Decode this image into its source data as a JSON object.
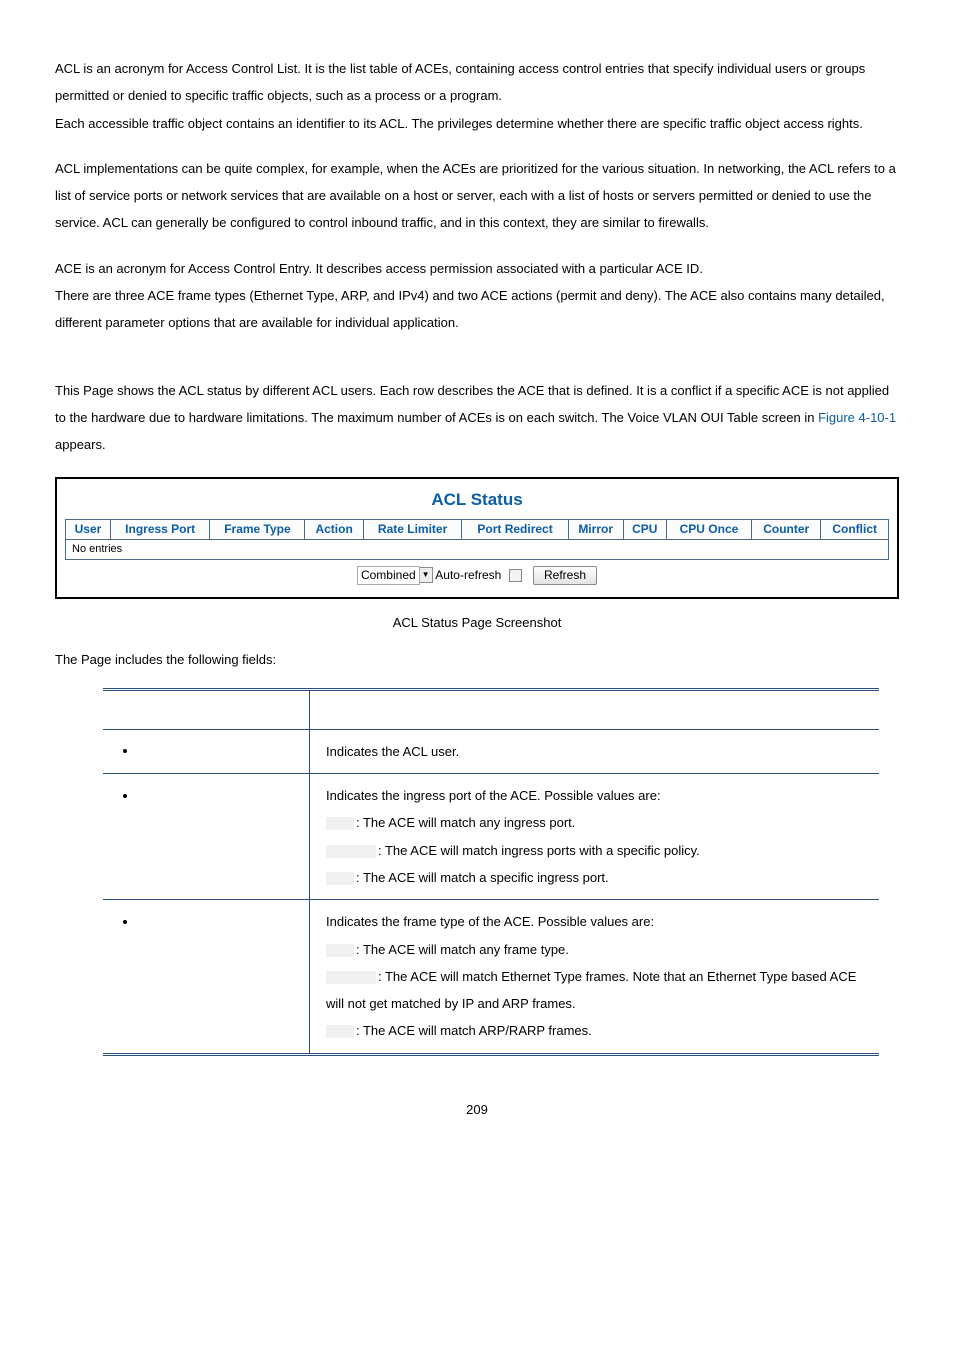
{
  "para1": "ACL is an acronym for Access Control List. It is the list table of ACEs, containing access control entries that specify individual users or groups permitted or denied to specific traffic objects, such as a process or a program.",
  "para1b": "Each accessible traffic object contains an identifier to its ACL. The privileges determine whether there are specific traffic object access rights.",
  "para2": "ACL implementations can be quite complex, for example, when the ACEs are prioritized for the various situation. In networking, the ACL refers to a list of service ports or network services that are available on a host or server, each with a list of hosts or servers permitted or denied to use the service. ACL can generally be configured to control inbound traffic, and in this context, they are similar to firewalls.",
  "para3a": "ACE is an acronym for Access Control Entry. It describes access permission associated with a particular ACE ID.",
  "para3b": "There are three ACE frame types (Ethernet Type, ARP, and IPv4) and two ACE actions (permit and deny). The ACE also contains many detailed, different parameter options that are available for individual application.",
  "para4_pre": "This Page shows the ACL status by different ACL users. Each row describes the ACE that is defined. It is a conflict if a specific ACE is not applied to the hardware due to hardware limitations. The maximum number of ACEs is ",
  "para4_post": " on each switch. The Voice VLAN OUI Table screen in ",
  "figref": "Figure 4-10-1",
  "para4_end": " appears.",
  "ss": {
    "title": "ACL Status",
    "cols": [
      "User",
      "Ingress Port",
      "Frame Type",
      "Action",
      "Rate Limiter",
      "Port Redirect",
      "Mirror",
      "CPU",
      "CPU Once",
      "Counter",
      "Conflict"
    ],
    "row": "No entries",
    "select_value": "Combined",
    "auto_label": "Auto-refresh",
    "refresh": "Refresh"
  },
  "figcap": "ACL Status Page Screenshot",
  "fields_lead": "The Page includes the following fields:",
  "fields": {
    "user": {
      "desc": "Indicates the ACL user."
    },
    "ingress": {
      "desc": "Indicates the ingress port of the ACE. Possible values are:",
      "l1": ": The ACE will match any ingress port.",
      "l2": ": The ACE will match ingress ports with a specific policy.",
      "l3": ": The ACE will match a specific ingress port."
    },
    "frame": {
      "desc": "Indicates the frame type of the ACE. Possible values are:",
      "l1": ": The ACE will match any frame type.",
      "l2": ": The ACE will match Ethernet Type frames. Note that an Ethernet Type based ACE will not get matched by IP and ARP frames.",
      "l3": ": The ACE will match ARP/RARP frames."
    }
  },
  "page_number": "209"
}
